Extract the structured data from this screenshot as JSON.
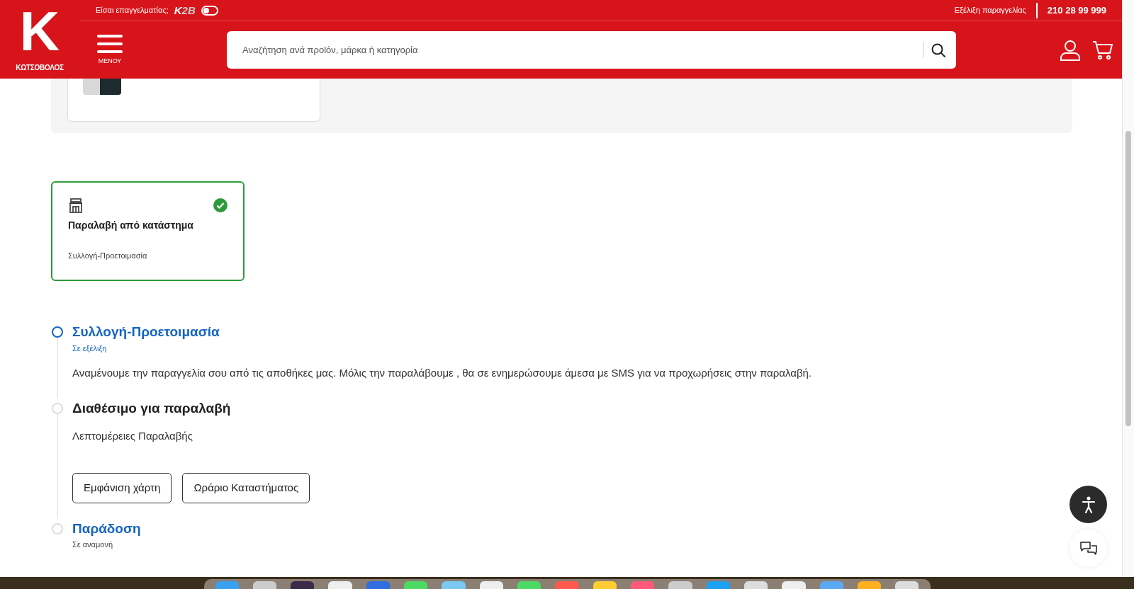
{
  "header": {
    "pro_prompt": "Είσαι επαγγελματίας;",
    "k2b_logo": {
      "k": "K",
      "rest": "2B"
    },
    "pro_toggle": {
      "on": false
    },
    "logo_text": "ΚΩΤΣΟΒΟΛΟΣ",
    "logo_letter": "K",
    "menu_label": "ΜΕΝΟΥ",
    "order_tracking": "Εξέλιξη παραγγελίας",
    "phone": "210 28 99 999",
    "search": {
      "placeholder": "Αναζήτηση ανά προϊόν, μάρκα ή κατηγορία"
    }
  },
  "delivery_option": {
    "title": "Παραλαβή από κατάστημα",
    "status": "Συλλογή-Προετοιμασία",
    "selected": true
  },
  "steps": [
    {
      "title": "Συλλογή-Προετοιμασία",
      "active": true,
      "link": true,
      "status": "Σε εξέλιξη",
      "description": "Αναμένουμε την παραγγελία σου από τις αποθήκες μας. Μόλις την παραλάβουμε , θα σε ενημερώσουμε άμεσα με SMS για να προχωρήσεις στην παραλαβή."
    },
    {
      "title": "Διαθέσιμο για παραλαβή",
      "active": false,
      "link": false,
      "subtitle": "Λεπτομέρειες Παραλαβής",
      "buttons": [
        "Εμφάνιση χάρτη",
        "Ωράριο Καταστήματος"
      ]
    },
    {
      "title": "Παράδοση",
      "active": false,
      "link": true,
      "status": "Σε αναμονή"
    }
  ]
}
